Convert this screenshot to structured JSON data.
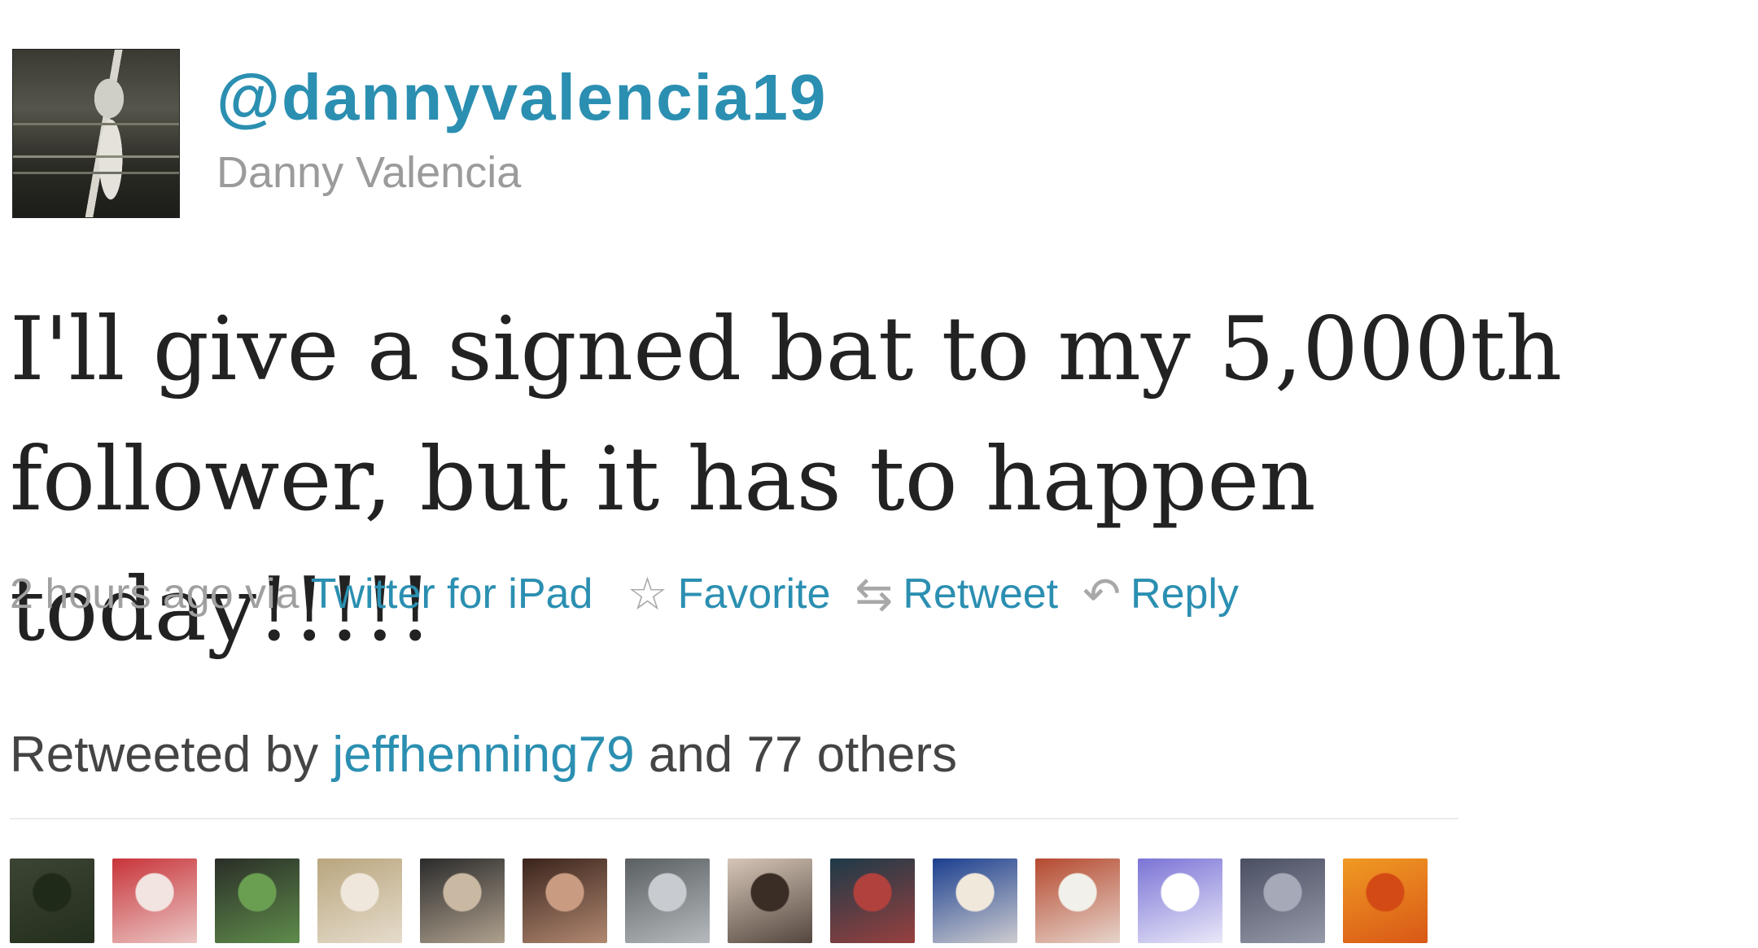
{
  "tweet": {
    "username": "@dannyvalencia19",
    "fullname": "Danny Valencia",
    "text": "I'll give a signed bat to my 5,000th follower, but it has to happen today!!!!!",
    "timestamp": "2 hours ago via",
    "source": "Twitter for iPad",
    "actions": {
      "favorite": {
        "icon": "star-icon",
        "label": "Favorite"
      },
      "retweet": {
        "icon": "retweet-icon",
        "label": "Retweet"
      },
      "reply": {
        "icon": "reply-icon",
        "label": "Reply"
      }
    }
  },
  "retweeted": {
    "prefix": "Retweeted by",
    "user": "jeffhenning79",
    "suffix": "and 77 others"
  },
  "retweeter_avatars": [
    {
      "colors": [
        "#3c4434",
        "#1f2a18"
      ]
    },
    {
      "colors": [
        "#c8343a",
        "#f2e4e0"
      ]
    },
    {
      "colors": [
        "#2a2e28",
        "#6a9f52"
      ]
    },
    {
      "colors": [
        "#b9a67e",
        "#efe7dc"
      ]
    },
    {
      "colors": [
        "#2b2b2b",
        "#c9b8a2"
      ]
    },
    {
      "colors": [
        "#3a241c",
        "#c99c82"
      ]
    },
    {
      "colors": [
        "#5a5f62",
        "#c8ccd0"
      ]
    },
    {
      "colors": [
        "#d6c6b8",
        "#3a2d26"
      ]
    },
    {
      "colors": [
        "#1d3a48",
        "#b0413d"
      ]
    },
    {
      "colors": [
        "#1b3f8f",
        "#f1e8dc"
      ]
    },
    {
      "colors": [
        "#b5492f",
        "#f1f0ea"
      ]
    },
    {
      "colors": [
        "#7b74d6",
        "#ffffff"
      ]
    },
    {
      "colors": [
        "#4a4f62",
        "#a5a9b8"
      ]
    },
    {
      "colors": [
        "#f09a23",
        "#d44a14"
      ]
    }
  ],
  "colors": {
    "link": "#2b8fb1",
    "muted": "#a0a0a0",
    "text": "#222222"
  }
}
